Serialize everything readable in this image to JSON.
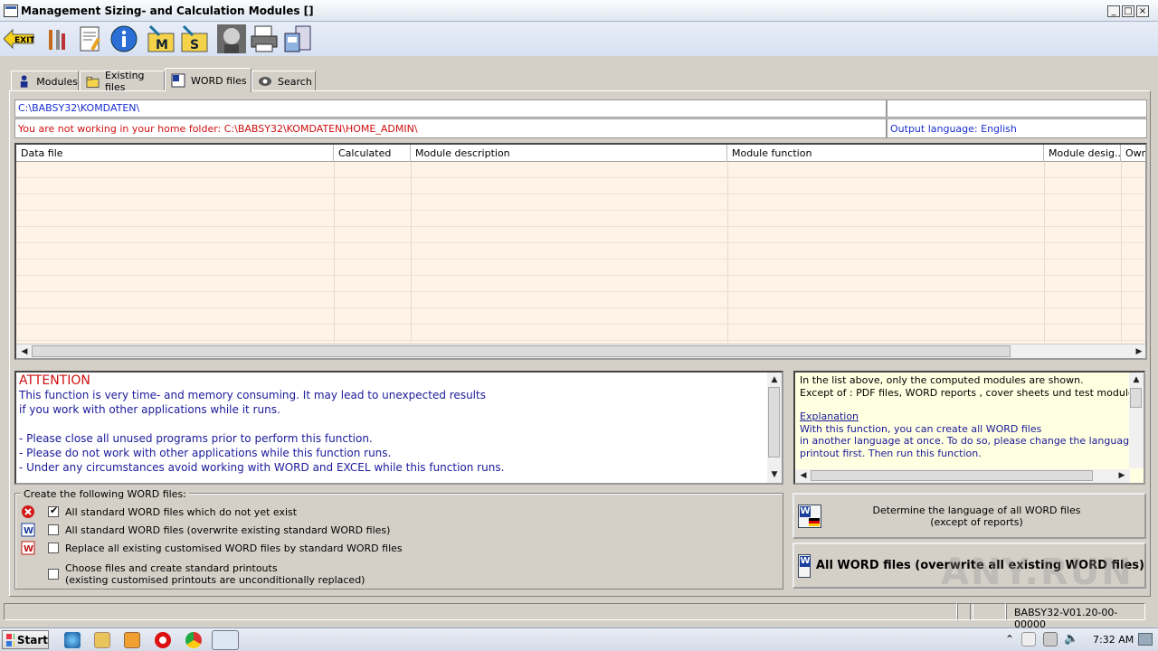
{
  "window": {
    "title": "Management Sizing- and Calculation Modules []",
    "minimize": "_",
    "maximize": "□",
    "close": "×"
  },
  "toolbar": {
    "exit_label": "EXIT",
    "m_label": "M",
    "s_label": "S"
  },
  "tabs": [
    {
      "label": "Modules",
      "icon": "modules-icon"
    },
    {
      "label": "Existing files",
      "icon": "folder-icon"
    },
    {
      "label": "WORD files",
      "icon": "word-icon"
    },
    {
      "label": "Search",
      "icon": "search-icon"
    }
  ],
  "active_tab": "WORD files",
  "paths": {
    "current": "C:\\BABSY32\\KOMDATEN\\",
    "warning": "You are not working in your home folder: C:\\BABSY32\\KOMDATEN\\HOME_ADMIN\\",
    "output_language": "Output language: English"
  },
  "grid": {
    "columns": [
      "Data file",
      "Calculated",
      "Module description",
      "Module function",
      "Module desig...",
      "Own"
    ],
    "rows": []
  },
  "attention": {
    "title": "ATTENTION",
    "lines": [
      "This function is very time- and memory consuming. It may lead to unexpected results",
      "if you work with other applications while it runs.",
      "",
      "- Please close all unused programs prior to perform this function.",
      "- Please do not work with other applications while this function runs.",
      "- Under any circumstances avoid working with WORD and EXCEL while this function runs."
    ]
  },
  "info": {
    "line1": "In the list above, only the computed modules are shown.",
    "line2": "Except of : PDF files, WORD reports , cover sheets und test modules",
    "explanation": "Explanation",
    "line3": "With this function, you can create all WORD files",
    "line4": "in another language at once. To do so, please change the language for the W",
    "line5": "printout first. Then run this function."
  },
  "options": {
    "group_label": "Create the following WORD files:",
    "items": [
      {
        "label": "All standard WORD files which do not yet exist",
        "checked": true,
        "icon": "error-icon"
      },
      {
        "label": "All standard WORD files (overwrite existing standard WORD files)",
        "checked": false,
        "icon": "word-blue-icon"
      },
      {
        "label": "Replace all existing customised WORD files by standard WORD files",
        "checked": false,
        "icon": "word-red-icon"
      },
      {
        "label": "Choose files and create standard printouts",
        "label2": "(existing customised printouts  are unconditionally replaced)",
        "checked": false
      }
    ]
  },
  "buttons": {
    "determine_line1": "Determine the language of all WORD files",
    "determine_line2": "(except of reports)",
    "all_word": "All WORD files (overwrite all existing WORD files)"
  },
  "status": {
    "version": "BABSY32-V01.20-00-00000"
  },
  "taskbar": {
    "start": "Start",
    "clock": "7:32 AM"
  },
  "watermark": "ANY.RUN"
}
